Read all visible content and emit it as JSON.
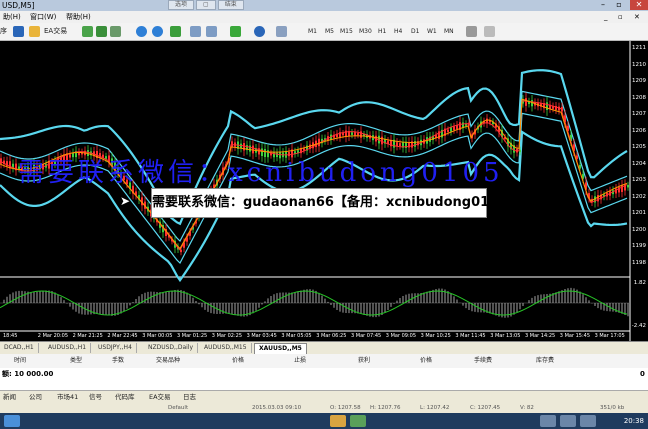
{
  "window": {
    "title": "USD,M5]"
  },
  "titlebar_center": [
    "选项",
    "",
    "结束"
  ],
  "menu": [
    "助(H)",
    "窗口(W)",
    "帮助(H)"
  ],
  "toolbar": {
    "ea_label": "EA交易",
    "timeframes": [
      "M1",
      "M5",
      "M15",
      "M30",
      "H1",
      "H4",
      "D1",
      "W1",
      "MN"
    ]
  },
  "chart": {
    "price_labels": [
      "1211",
      "1210",
      "1209",
      "1208",
      "1207",
      "1206",
      "1205",
      "1204",
      "1203",
      "1202",
      "1201",
      "1200",
      "1199",
      "1198"
    ],
    "osc_labels": [
      "1.82",
      "-2.42"
    ],
    "time_labels": [
      "18:45",
      "2 Mar 20:05",
      "2 Mar 21:25",
      "2 Mar 22:45",
      "3 Mar 00:05",
      "3 Mar 01:25",
      "3 Mar 02:25",
      "3 Mar 03:45",
      "3 Mar 05:05",
      "3 Mar 06:25",
      "3 Mar 07:45",
      "3 Mar 09:05",
      "3 Mar 10:25",
      "3 Mar 11:45",
      "3 Mar 13:05",
      "3 Mar 14:25",
      "3 Mar 15:45",
      "3 Mar 17:05"
    ],
    "colors": {
      "band": "#5ad8ef",
      "bull": "#3ecf3e",
      "bear": "#ff3030",
      "ma": "#ff9900"
    }
  },
  "watermark": {
    "blue_text": "需要联系微信：xcnibudong0105",
    "box_text": "需要联系微信：gudaonan66【备用：xcnibudong0105】"
  },
  "chart_tabs": [
    "DCAD,,H1",
    "AUDUSD,,H1",
    "USDJPY,,H4",
    "NZDUSD,,Daily",
    "AUDUSD,,M15",
    "XAUUSD,,M5"
  ],
  "active_chart_tab": "XAUUSD,,M5",
  "terminal": {
    "headers": [
      "时间",
      "类型",
      "手数",
      "交易品种",
      "价格",
      "止损",
      "获利",
      "价格",
      "手续费",
      "库存费"
    ],
    "balance_label": "额: 10 000.00",
    "balance_value": "0"
  },
  "terminal_tabs": [
    "新闻",
    "公司",
    "市场41",
    "信号",
    "代码库",
    "EA交易",
    "日志"
  ],
  "status": {
    "profile": "Default",
    "datetime": "2015.03.03 09:10",
    "open": "O: 1207.58",
    "high": "H: 1207.76",
    "low": "L: 1207.42",
    "close": "C: 1207.45",
    "volume": "V: 82",
    "traffic": "351/0 kb"
  },
  "taskbar": {
    "time": "20:38"
  }
}
